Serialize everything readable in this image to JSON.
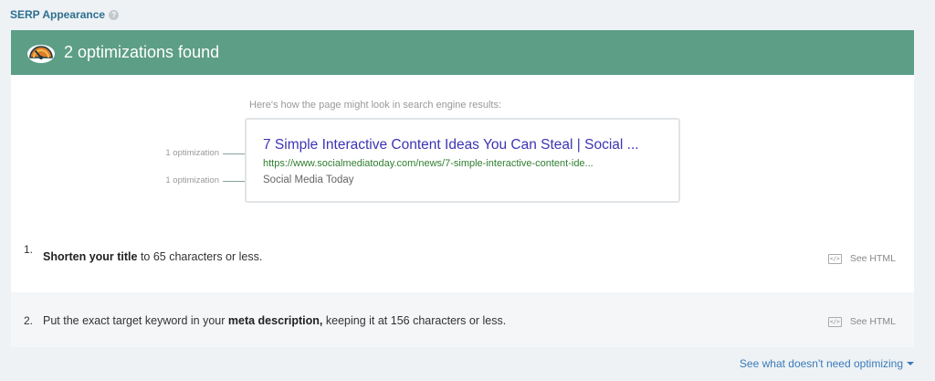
{
  "section": {
    "title": "SERP Appearance",
    "help_glyph": "?"
  },
  "banner": {
    "title": "2 optimizations found",
    "color": "#5d9e86"
  },
  "preview": {
    "caption": "Here's how the page might look in search engine results:",
    "serp_title": "7 Simple Interactive Content Ideas You Can Steal | Social ...",
    "serp_url": "https://www.socialmediatoday.com/news/7-simple-interactive-content-ide...",
    "serp_site": "Social Media Today",
    "title_opt_label": "1 optimization",
    "site_opt_label": "1 optimization"
  },
  "optimizations": [
    {
      "number": "1.",
      "bold": "Shorten your title",
      "rest": " to 65 characters or less.",
      "action_label": "See HTML",
      "icon_text": "</>"
    },
    {
      "number": "2.",
      "pre": "Put the exact target keyword in your ",
      "bold": "meta description,",
      "rest": " keeping it at 156 characters or less.",
      "action_label": "See HTML",
      "icon_text": "</>"
    }
  ],
  "footer": {
    "link_label": "See what doesn't need optimizing"
  }
}
